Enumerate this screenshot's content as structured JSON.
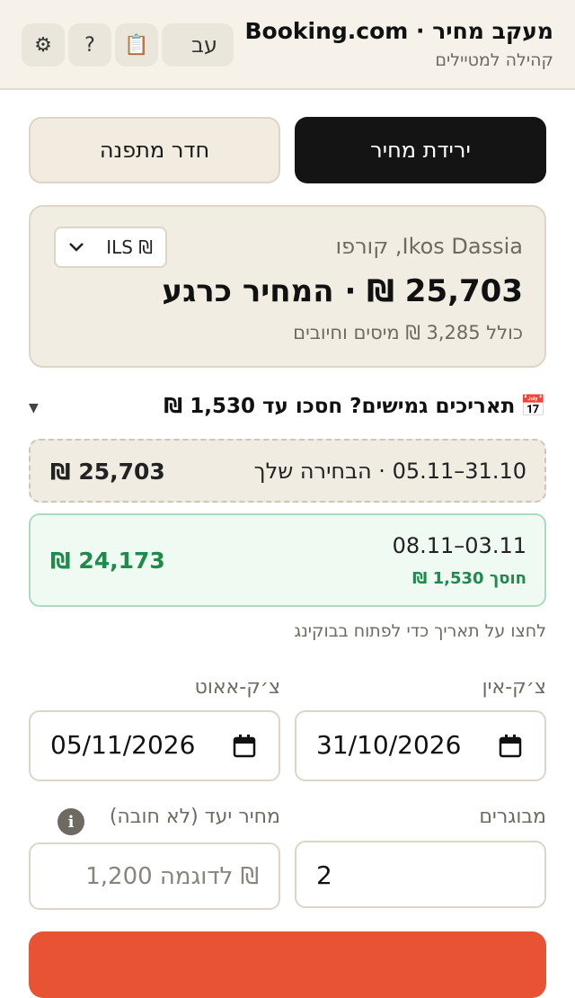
{
  "header": {
    "title": "מעקב מחיר · Booking.com",
    "subtitle": "קהילה למטיילים",
    "lang_label": "עב",
    "clipboard_icon": "📋",
    "help_icon": "?",
    "gear_icon": "⚙"
  },
  "tabs": [
    {
      "label": "ירידת מחיר",
      "active": true
    },
    {
      "label": "חדר מתפנה",
      "active": false
    }
  ],
  "price_card": {
    "hotel": "Ikos Dassia, קורפו",
    "price": "25,703 ₪ · המחיר כרגע",
    "note": "כולל 3,285 ₪ מיסים וחיובים",
    "currency": "₪ ILS"
  },
  "flex_dates": {
    "icon": "📅",
    "title": "תאריכים גמישים? חסכו עד 1,530 ₪",
    "caret": "▼"
  },
  "date_options": [
    {
      "range": "31.10–05.11 · הבחירה שלך",
      "price": "25,703 ₪"
    },
    {
      "range": "03.11–08.11",
      "saving": "חוסך 1,530 ₪",
      "price": "24,173 ₪"
    }
  ],
  "hint": "לחצו על תאריך כדי לפתוח בבוקינג",
  "form": {
    "checkin_label": "צ׳ק-אין",
    "checkout_label": "צ׳ק-אאוט",
    "checkin_value": "31/10/2026",
    "checkout_value": "05/11/2026",
    "adults_label": "מבוגרים",
    "adults_value": "2",
    "target_label": "מחיר יעד (לא חובה)",
    "target_placeholder": "₪ לדוגמה 1,200",
    "info_icon": "i"
  },
  "colors": {
    "accent": "#e85433",
    "savings_green": "#1f8a4c",
    "header_bg": "#f6f2ea"
  }
}
